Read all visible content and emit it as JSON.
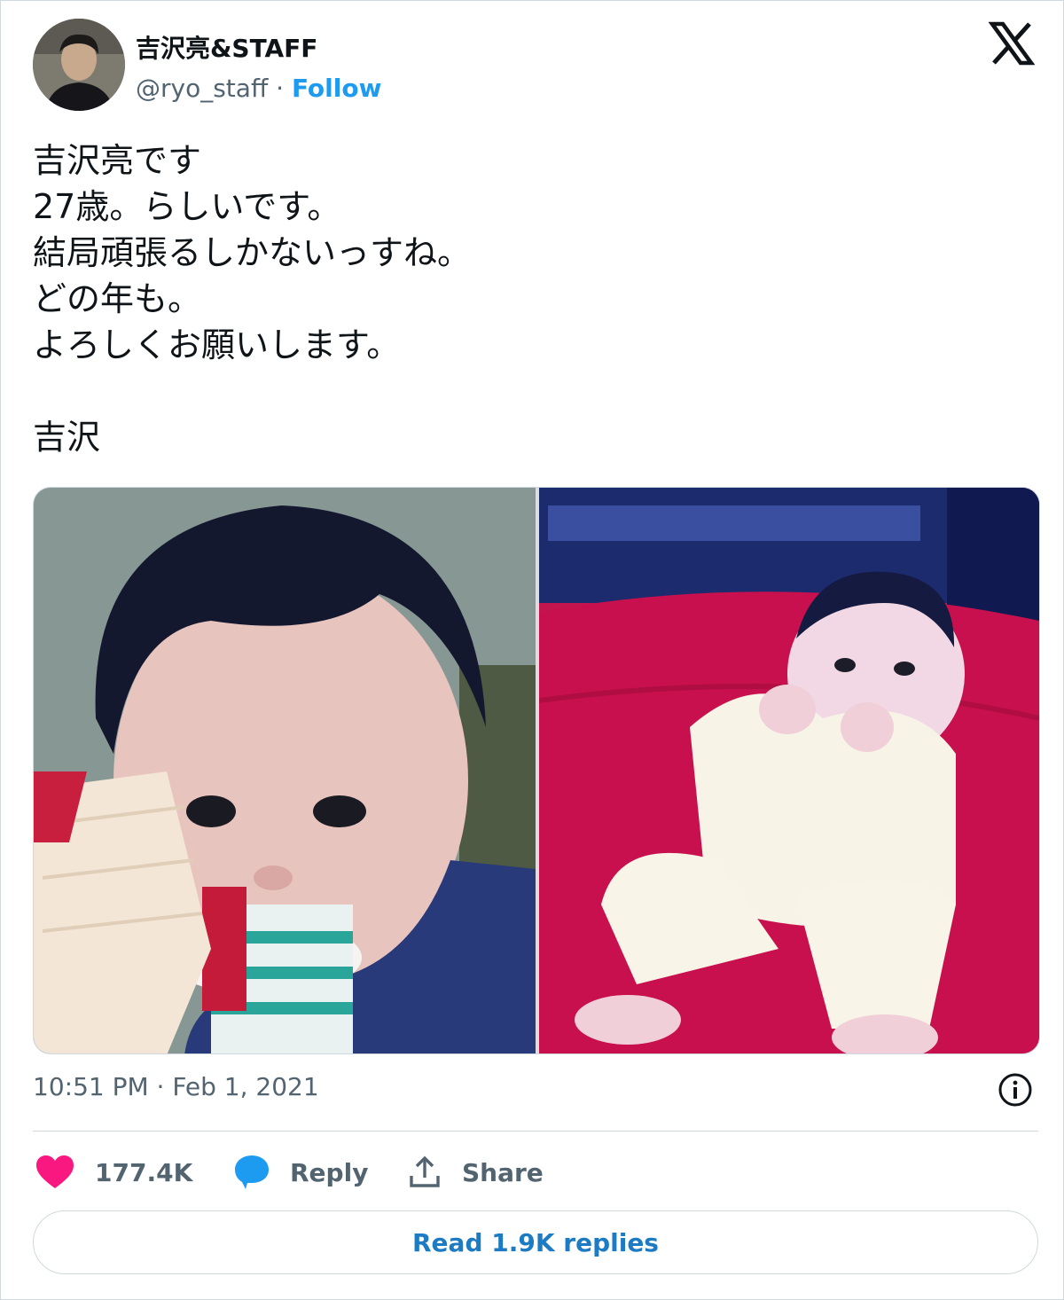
{
  "author": {
    "display_name": "吉沢亮&STAFF",
    "handle": "@ryo_staff",
    "separator": " · ",
    "follow_label": "Follow"
  },
  "tweet": {
    "lines": [
      "吉沢亮です",
      "27歳。らしいです。",
      "結局頑張るしかないっすね。",
      "どの年も。",
      "よろしくお願いします。",
      "",
      "吉沢"
    ],
    "timestamp": "10:51 PM · Feb 1, 2021"
  },
  "media": {
    "count": 2
  },
  "actions": {
    "like_count": "177.4K",
    "reply_label": "Reply",
    "share_label": "Share",
    "read_replies_label": "Read 1.9K replies"
  },
  "icons": {
    "brand": "x-logo-icon",
    "like": "heart-icon",
    "reply": "speech-bubble-icon",
    "share": "share-upload-icon",
    "info": "info-icon"
  },
  "colors": {
    "accent": "#1d9bf0",
    "like": "#f91880",
    "muted": "#536471",
    "text": "#0f1419",
    "border": "#cfd9de"
  }
}
